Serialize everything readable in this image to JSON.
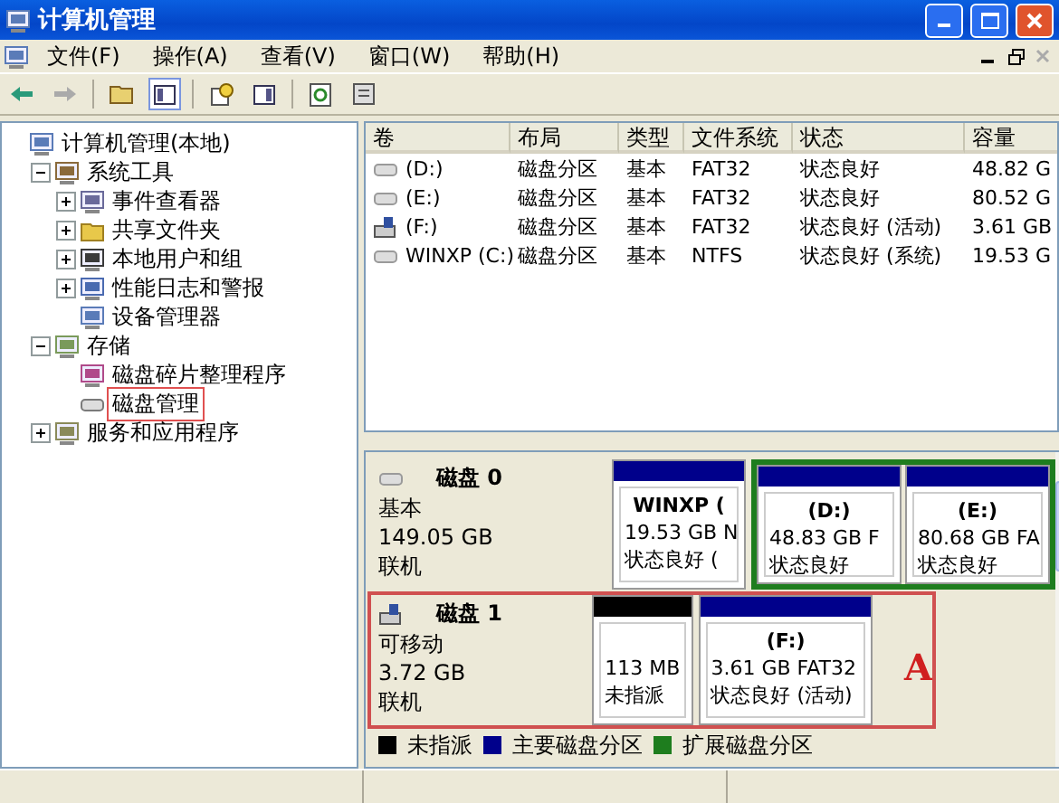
{
  "window": {
    "title": "计算机管理"
  },
  "menu": [
    "文件(F)",
    "操作(A)",
    "查看(V)",
    "窗口(W)",
    "帮助(H)"
  ],
  "tree": [
    {
      "label": "计算机管理(本地)",
      "children": [
        {
          "label": "系统工具",
          "expanded": true,
          "children": [
            {
              "label": "事件查看器",
              "expanded": false
            },
            {
              "label": "共享文件夹",
              "expanded": false
            },
            {
              "label": "本地用户和组",
              "expanded": false
            },
            {
              "label": "性能日志和警报",
              "expanded": false
            },
            {
              "label": "设备管理器"
            }
          ]
        },
        {
          "label": "存储",
          "expanded": true,
          "children": [
            {
              "label": "磁盘碎片整理程序"
            },
            {
              "label": "磁盘管理",
              "highlighted": true
            }
          ]
        },
        {
          "label": "服务和应用程序",
          "expanded": false
        }
      ]
    }
  ],
  "table": {
    "columns": [
      "卷",
      "布局",
      "类型",
      "文件系统",
      "状态",
      "容量"
    ],
    "rows": [
      {
        "kind": "fixed",
        "cells": [
          "(D:)",
          "磁盘分区",
          "基本",
          "FAT32",
          "状态良好",
          "48.82 G"
        ]
      },
      {
        "kind": "fixed",
        "cells": [
          "(E:)",
          "磁盘分区",
          "基本",
          "FAT32",
          "状态良好",
          "80.52 G"
        ]
      },
      {
        "kind": "removable",
        "cells": [
          "(F:)",
          "磁盘分区",
          "基本",
          "FAT32",
          "状态良好 (活动)",
          "3.61 GB"
        ]
      },
      {
        "kind": "fixed",
        "cells": [
          "WINXP (C:)",
          "磁盘分区",
          "基本",
          "NTFS",
          "状态良好 (系统)",
          "19.53 G"
        ]
      }
    ]
  },
  "disks": [
    {
      "name": "磁盘 0",
      "kind": "fixed",
      "type": "基本",
      "size": "149.05 GB",
      "status": "联机",
      "highlighted": false,
      "partitions": [
        {
          "kind": "primary",
          "lines": [
            "WINXP  (",
            "19.53 GB N",
            "状态良好 ("
          ]
        },
        {
          "kind": "extended",
          "children": [
            {
              "kind": "primary",
              "lines": [
                "(D:)",
                "48.83 GB F",
                "状态良好"
              ]
            },
            {
              "kind": "primary",
              "lines": [
                "(E:)",
                "80.68 GB FA",
                "状态良好"
              ]
            }
          ]
        }
      ]
    },
    {
      "name": "磁盘 1",
      "kind": "removable",
      "type": "可移动",
      "size": "3.72 GB",
      "status": "联机",
      "highlighted": true,
      "partitions": [
        {
          "kind": "unallocated",
          "lines": [
            "113 MB",
            "未指派"
          ]
        },
        {
          "kind": "primary",
          "lines": [
            "(F:)",
            "3.61 GB FAT32",
            "状态良好 (活动)"
          ]
        }
      ]
    }
  ],
  "annotation": "A",
  "legend": [
    {
      "label": "未指派",
      "color": "#000000"
    },
    {
      "label": "主要磁盘分区",
      "color": "#00008b"
    },
    {
      "label": "扩展磁盘分区",
      "color": "#1e7d1e"
    }
  ]
}
